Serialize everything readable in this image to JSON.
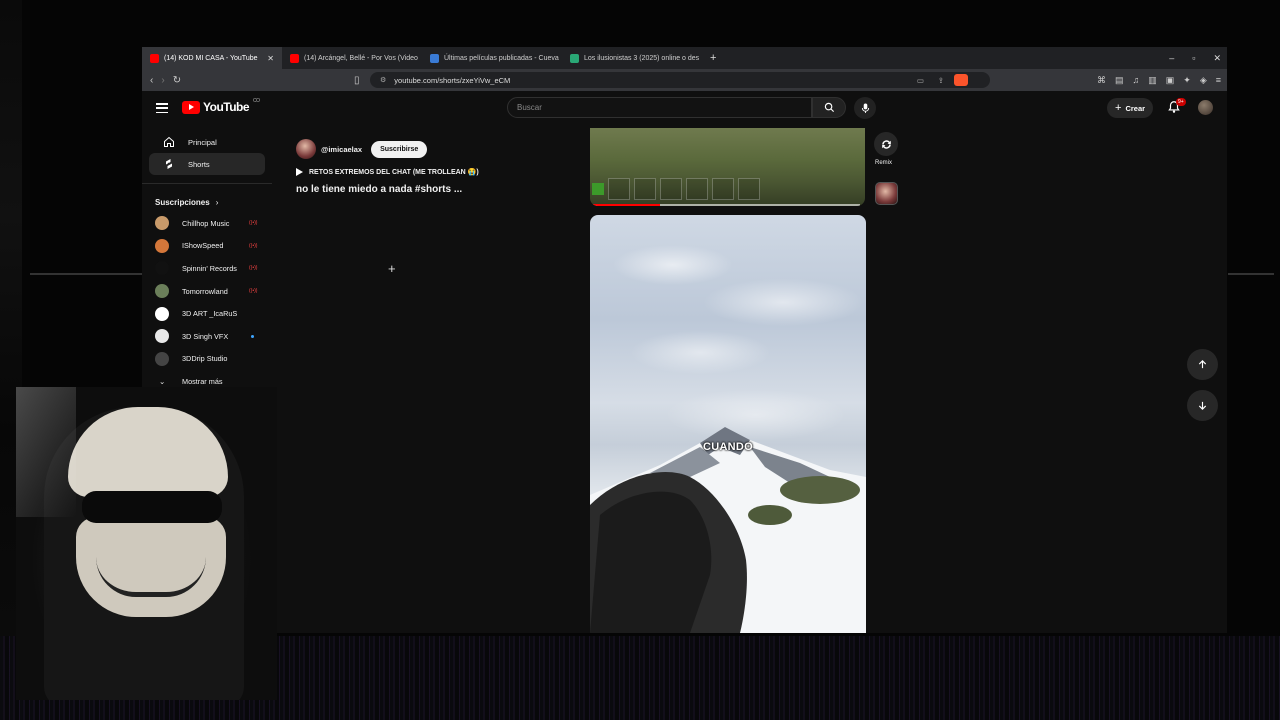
{
  "tabs": [
    {
      "label": "(14) KOD MI CASA - YouTube",
      "active": true,
      "fav_color": "#ff0000"
    },
    {
      "label": "(14) Arcángel, Bellé - Por Vos (Video",
      "active": false,
      "fav_color": "#ff0000"
    },
    {
      "label": "Últimas películas publicadas - Cueva",
      "active": false,
      "fav_color": "#3a7bd5"
    },
    {
      "label": "Los ilusionistas 3 (2025) online o des",
      "active": false,
      "fav_color": "#2aa876"
    }
  ],
  "url": "youtube.com/shorts/zxeYiVw_eCM",
  "header": {
    "logo_text": "YouTube",
    "country_code": "CO",
    "search_placeholder": "Buscar",
    "create_label": "Crear",
    "notif_badge": "9+"
  },
  "sidebar": {
    "items": [
      {
        "label": "Principal",
        "icon": "home-icon"
      },
      {
        "label": "Shorts",
        "icon": "shorts-icon",
        "active": true
      }
    ],
    "subs_heading": "Suscripciones",
    "subscriptions": [
      {
        "label": "Chillhop Music",
        "color": "#c89a6a",
        "live": true
      },
      {
        "label": "IShowSpeed",
        "color": "#d4773a",
        "live": true
      },
      {
        "label": "Spinnin' Records",
        "color": "#111111",
        "live": true
      },
      {
        "label": "Tomorrowland",
        "color": "#6b7f5a",
        "live": true
      },
      {
        "label": "3D ART _IcaRuS",
        "color": "#ffffff",
        "live": false
      },
      {
        "label": "3D Singh VFX",
        "color": "#e8e8e8",
        "live": false,
        "dot": true
      },
      {
        "label": "3DDrip Studio",
        "color": "#444444",
        "live": false
      }
    ],
    "show_more": "Mostrar más",
    "live_text": "((•))"
  },
  "short": {
    "channel": "@imicaelax",
    "subscribe_label": "Suscribirse",
    "playlist": "RETOS EXTREMOS DEL CHAT (ME TROLLEAN 😭)",
    "title": "no le tiene miedo a nada #shorts ...",
    "caption": "CUANDO",
    "remix_label": "Remix",
    "progress_fraction": 0.26
  }
}
